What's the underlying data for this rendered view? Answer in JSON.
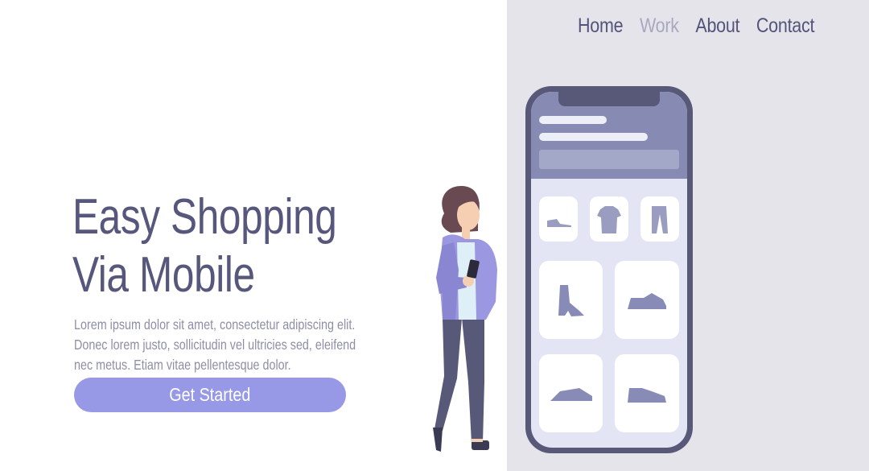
{
  "nav": {
    "items": [
      {
        "label": "Home",
        "active": false
      },
      {
        "label": "Work",
        "active": true
      },
      {
        "label": "About",
        "active": false
      },
      {
        "label": "Contact",
        "active": false
      }
    ]
  },
  "hero": {
    "title_line1": "Easy Shopping",
    "title_line2": "Via Mobile",
    "description": "Lorem ipsum dolor sit amet, consectetur adipiscing elit. Donec lorem justo, sollicitudin vel ultricies sed, eleifend nec metus. Etiam vitae pellentesque dolor.",
    "cta_label": "Get Started"
  },
  "illustration": {
    "products": [
      "shoe-icon",
      "tshirt-icon",
      "pants-icon",
      "boot-icon",
      "sneaker-icon",
      "sneaker-icon",
      "sneaker-icon"
    ]
  },
  "colors": {
    "primary": "#57577d",
    "nav_active": "#a8a8bf",
    "accent": "#9799e7",
    "panel_bg": "#e5e4eb",
    "text_muted": "#8e8ea8"
  }
}
